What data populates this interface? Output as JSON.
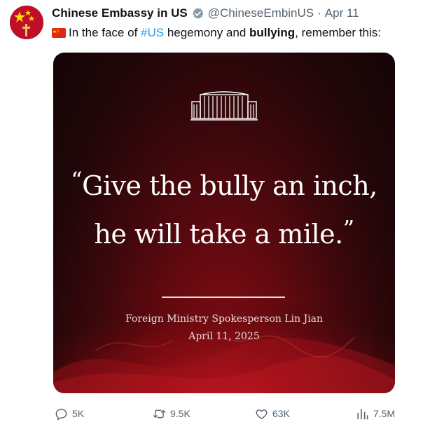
{
  "post": {
    "author_name": "Chinese Embassy in US",
    "handle": "@ChineseEmbinUS",
    "separator": "·",
    "date": "Apr 11",
    "text_before": "In the face of ",
    "hashtag": "#US",
    "text_middle": " hegemony and ",
    "bold_word": "bullying",
    "text_after": ", remember this:"
  },
  "media": {
    "quote_line1": "Give the bully an inch,",
    "quote_line2": "he will take a mile.",
    "open_quote": "“",
    "close_quote": "”",
    "attribution": "Foreign Ministry Spokesperson Lin Jian",
    "date": "April 11, 2025"
  },
  "actions": {
    "replies": "5K",
    "reposts": "9.5K",
    "likes": "63K",
    "views": "7.5M"
  },
  "icons": {
    "avatar": "china-flag-avatar-icon",
    "verified": "verified-badge-icon",
    "flag": "china-flag-icon",
    "reply": "reply-icon",
    "repost": "repost-icon",
    "like": "heart-icon",
    "views": "views-bar-chart-icon"
  },
  "colors": {
    "link": "#1d9bf0",
    "secondary_text": "#536471",
    "flag_red": "#de2910",
    "flag_yellow": "#ffde00"
  }
}
